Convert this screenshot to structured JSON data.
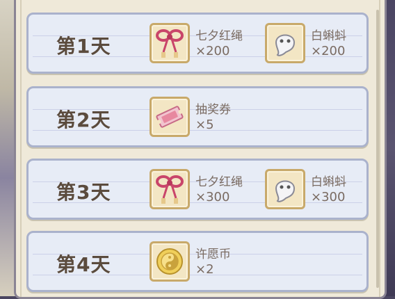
{
  "days": [
    {
      "label": "第1天",
      "rewards": [
        {
          "name": "七夕红绳",
          "count": "×200",
          "icon": "red-rope-icon"
        },
        {
          "name": "白蝌蚪",
          "count": "×200",
          "icon": "white-tadpole-icon"
        }
      ]
    },
    {
      "label": "第2天",
      "rewards": [
        {
          "name": "抽奖券",
          "count": "×5",
          "icon": "lottery-ticket-icon"
        }
      ]
    },
    {
      "label": "第3天",
      "rewards": [
        {
          "name": "七夕红绳",
          "count": "×300",
          "icon": "red-rope-icon"
        },
        {
          "name": "白蝌蚪",
          "count": "×300",
          "icon": "white-tadpole-icon"
        }
      ]
    },
    {
      "label": "第4天",
      "rewards": [
        {
          "name": "许愿币",
          "count": "×2",
          "icon": "wish-coin-icon"
        }
      ]
    }
  ],
  "colors": {
    "row_bg": "#e7ecf6",
    "row_border": "#aab2cc",
    "day_text": "#5b4b3d",
    "item_text": "#7a6b62",
    "item_frame": "#c8a96a"
  }
}
